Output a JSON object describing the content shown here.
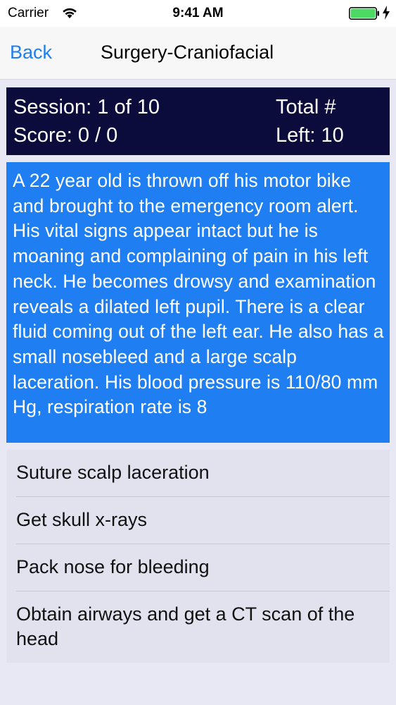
{
  "status_bar": {
    "carrier": "Carrier",
    "time": "9:41 AM",
    "battery_color": "#4cd964"
  },
  "nav": {
    "back_label": "Back",
    "title": "Surgery-Craniofacial"
  },
  "score_panel": {
    "session": "Session: 1 of 10",
    "score": "Score: 0 / 0",
    "total": "Total #",
    "left": "Left: 10"
  },
  "question": {
    "text": "A 22 year old is thrown off his motor bike and brought to the emergency room alert. His vital signs appear intact but he is moaning and complaining of pain in his left neck. He becomes drowsy and examination reveals a dilated left pupil. There is a clear fluid coming out of the left ear. He also has a small nosebleed and a large scalp laceration. His blood pressure is 110/80 mm Hg, respiration rate is 8"
  },
  "answers": [
    {
      "label": "Suture scalp laceration"
    },
    {
      "label": "Get skull x-rays"
    },
    {
      "label": "Pack nose for bleeding"
    },
    {
      "label": "Obtain airways and get a CT scan of the head"
    }
  ],
  "colors": {
    "accent": "#1f7ef0",
    "score_panel_bg": "#0b0c3b",
    "question_bg": "#1f7ff2"
  }
}
